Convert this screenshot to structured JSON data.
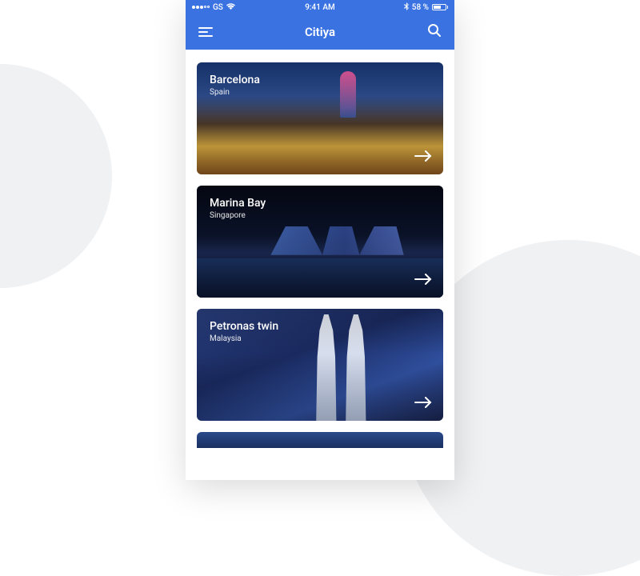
{
  "statusBar": {
    "carrier": "GS",
    "time": "9:41 AM",
    "battery": "58 %"
  },
  "header": {
    "title": "Citiya"
  },
  "cards": [
    {
      "title": "Barcelona",
      "subtitle": "Spain"
    },
    {
      "title": "Marina Bay",
      "subtitle": "Singapore"
    },
    {
      "title": "Petronas twin",
      "subtitle": "Malaysia"
    }
  ]
}
